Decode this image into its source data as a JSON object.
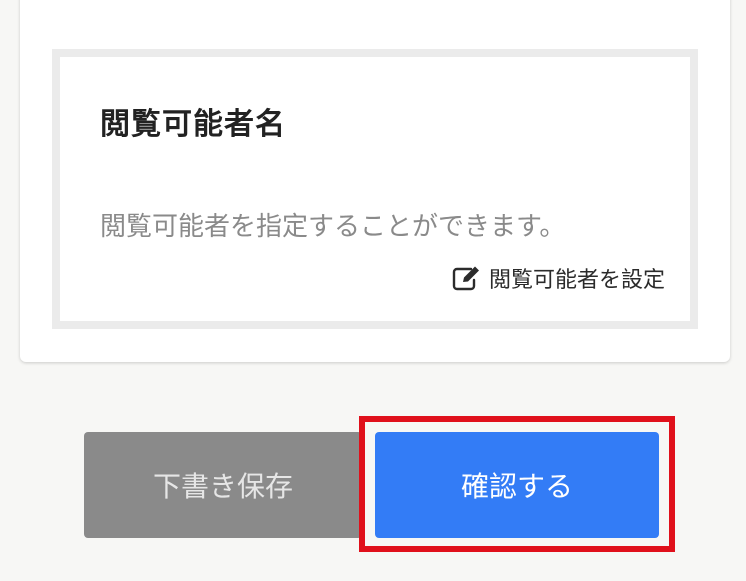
{
  "section": {
    "title": "閲覧可能者名",
    "description": "閲覧可能者を指定することができます。",
    "set_link_label": "閲覧可能者を設定",
    "set_link_icon": "edit-icon"
  },
  "actions": {
    "draft_label": "下書き保存",
    "confirm_label": "確認する"
  },
  "colors": {
    "draft_button": "#8a8a8a",
    "confirm_button": "#337cf6",
    "highlight_border": "#e0101b"
  }
}
